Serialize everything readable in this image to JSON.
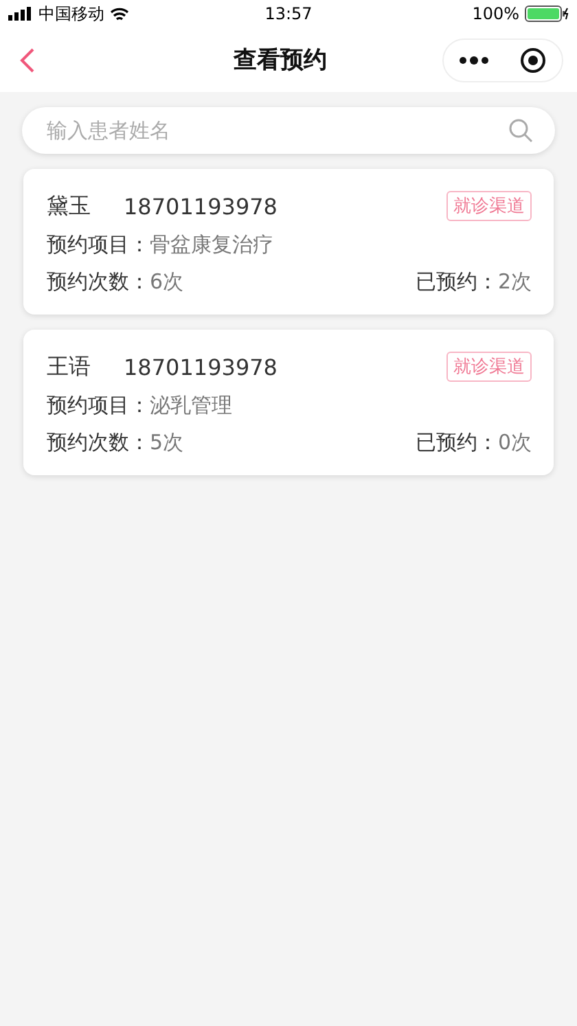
{
  "status_bar": {
    "carrier": "中国移动",
    "time": "13:57",
    "battery": "100%"
  },
  "nav": {
    "title": "查看预约"
  },
  "search": {
    "placeholder": "输入患者姓名"
  },
  "cards": [
    {
      "name": "黛玉",
      "phone": "18701193978",
      "tag": "就诊渠道",
      "item_label": "预约项目：",
      "item": "骨盆康复治疗",
      "count_label": "预约次数：",
      "count": "6次",
      "booked_label": "已预约：",
      "booked": "2次"
    },
    {
      "name": "王语",
      "phone": "18701193978",
      "tag": "就诊渠道",
      "item_label": "预约项目：",
      "item": "泌乳管理",
      "count_label": "预约次数：",
      "count": "5次",
      "booked_label": "已预约：",
      "booked": "0次"
    }
  ]
}
